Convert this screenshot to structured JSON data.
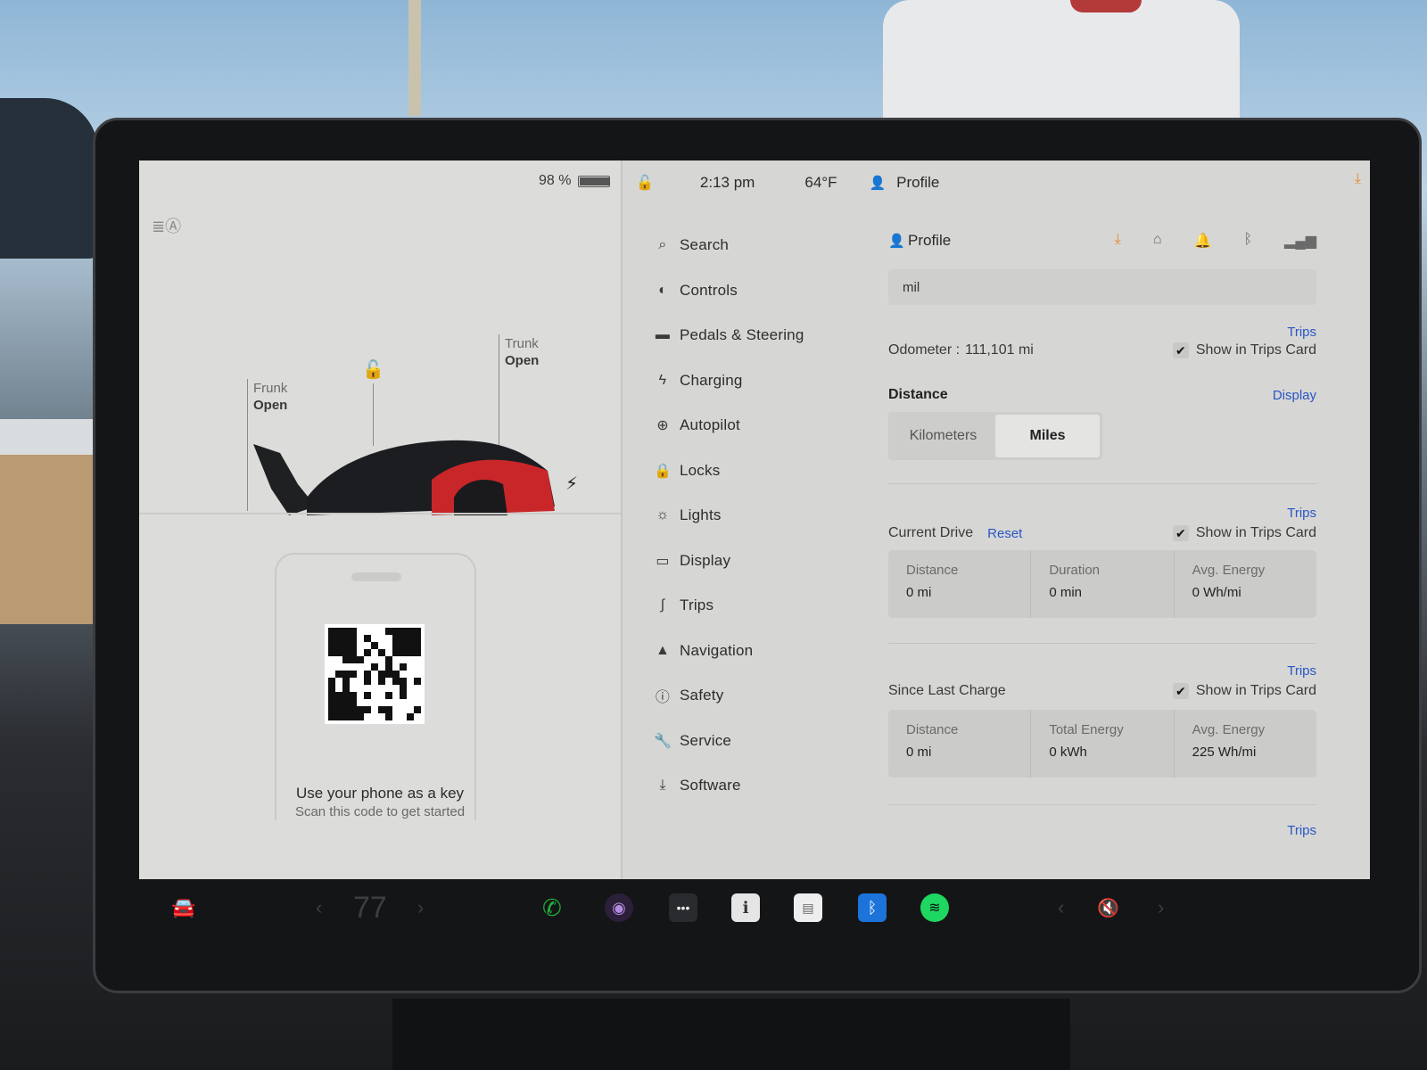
{
  "status": {
    "battery_percent": "98 %",
    "battery_level": 0.98,
    "time": "2:13 pm",
    "temperature": "64°F",
    "profile": "Profile"
  },
  "car": {
    "frunk_label": "Frunk",
    "frunk_state": "Open",
    "trunk_label": "Trunk",
    "trunk_state": "Open"
  },
  "phone_key": {
    "title": "Use your phone as a key",
    "subtitle": "Scan this code to get started"
  },
  "menu": {
    "items": [
      {
        "label": "Search",
        "icon": "search-icon"
      },
      {
        "label": "Controls",
        "icon": "toggle-icon"
      },
      {
        "label": "Pedals & Steering",
        "icon": "car-icon"
      },
      {
        "label": "Charging",
        "icon": "bolt-icon"
      },
      {
        "label": "Autopilot",
        "icon": "steering-wheel-icon"
      },
      {
        "label": "Locks",
        "icon": "lock-icon"
      },
      {
        "label": "Lights",
        "icon": "light-icon"
      },
      {
        "label": "Display",
        "icon": "display-icon"
      },
      {
        "label": "Trips",
        "icon": "trips-icon"
      },
      {
        "label": "Navigation",
        "icon": "navigation-icon"
      },
      {
        "label": "Safety",
        "icon": "safety-icon"
      },
      {
        "label": "Service",
        "icon": "wrench-icon"
      },
      {
        "label": "Software",
        "icon": "download-icon"
      }
    ]
  },
  "pane": {
    "profile_label": "Profile",
    "name_value": "mil",
    "odometer_label": "Odometer :",
    "odometer_value": "111,101 mi",
    "trips_link": "Trips",
    "show_in_trips": "Show in Trips Card",
    "distance_title": "Distance",
    "display_link": "Display",
    "unit_km": "Kilometers",
    "unit_miles": "Miles",
    "current_drive_title": "Current Drive",
    "reset_link": "Reset",
    "current_drive_stats": [
      {
        "label": "Distance",
        "value": "0 mi"
      },
      {
        "label": "Duration",
        "value": "0 min"
      },
      {
        "label": "Avg. Energy",
        "value": "0 Wh/mi"
      }
    ],
    "since_charge_title": "Since Last Charge",
    "since_charge_stats": [
      {
        "label": "Distance",
        "value": "0 mi"
      },
      {
        "label": "Total Energy",
        "value": "0 kWh"
      },
      {
        "label": "Avg. Energy",
        "value": "225 Wh/mi"
      }
    ]
  },
  "dock": {
    "cabin_temp": "77"
  },
  "colors": {
    "accent_blue": "#2a56c6",
    "download_orange": "#e58a2c",
    "phone_green": "#1fae3b",
    "spotify_green": "#1ed760",
    "bluetooth_blue": "#1c73d9"
  }
}
